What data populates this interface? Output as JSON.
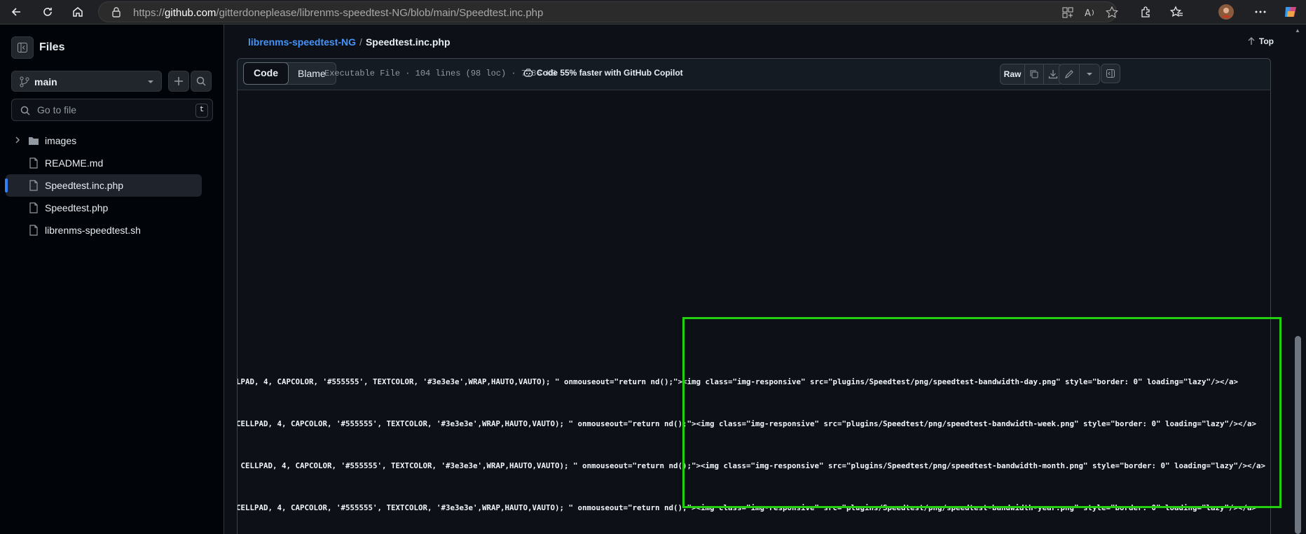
{
  "browser": {
    "url_prefix": "https://",
    "url_host": "github.com",
    "url_path": "/gitterdoneplease/librenms-speedtest-NG/blob/main/Speedtest.inc.php",
    "icons": [
      "back-icon",
      "refresh-icon",
      "home-icon",
      "lock-icon",
      "app-grid-icon",
      "read-aloud-icon",
      "favorite-star-icon",
      "extensions-icon",
      "favorites-icon",
      "profile-avatar",
      "more-icon",
      "copilot-icon"
    ]
  },
  "sidebar": {
    "title": "Files",
    "branch": "main",
    "search_placeholder": "Go to file",
    "search_shortcut": "t",
    "items": [
      {
        "label": "images",
        "type": "folder"
      },
      {
        "label": "README.md",
        "type": "file"
      },
      {
        "label": "Speedtest.inc.php",
        "type": "file",
        "active": true
      },
      {
        "label": "Speedtest.php",
        "type": "file"
      },
      {
        "label": "librenms-speedtest.sh",
        "type": "file"
      }
    ]
  },
  "main": {
    "repo": "librenms-speedtest-NG",
    "separator": "/",
    "file": "Speedtest.inc.php",
    "top_label": "Top",
    "tabs": [
      "Code",
      "Blame"
    ],
    "active_tab": "Code",
    "file_meta": "Executable File · 104 lines (98 loc) · 7.86 KB",
    "copilot_promo": "Code 55% faster with GitHub Copilot",
    "raw_label": "Raw"
  },
  "code_lines": [
    "LPAD, 4, CAPCOLOR, '#555555', TEXTCOLOR, '#3e3e3e',WRAP,HAUTO,VAUTO); \" onmouseout=\"return nd();\"><img class=\"img-responsive\" src=\"plugins/Speedtest/png/speedtest-bandwidth-day.png\" style=\"border: 0\" loading=\"lazy\"/></a>",
    "CELLPAD, 4, CAPCOLOR, '#555555', TEXTCOLOR, '#3e3e3e',WRAP,HAUTO,VAUTO); \" onmouseout=\"return nd();\"><img class=\"img-responsive\" src=\"plugins/Speedtest/png/speedtest-bandwidth-week.png\" style=\"border: 0\" loading=\"lazy\"/></a>",
    " CELLPAD, 4, CAPCOLOR, '#555555', TEXTCOLOR, '#3e3e3e',WRAP,HAUTO,VAUTO); \" onmouseout=\"return nd();\"><img class=\"img-responsive\" src=\"plugins/Speedtest/png/speedtest-bandwidth-month.png\" style=\"border: 0\" loading=\"lazy\"/></a>",
    "CELLPAD, 4, CAPCOLOR, '#555555', TEXTCOLOR, '#3e3e3e',WRAP,HAUTO,VAUTO); \" onmouseout=\"return nd();\"><img class=\"img-responsive\" src=\"plugins/Speedtest/png/speedtest-bandwidth-year.png\" style=\"border: 0\" loading=\"lazy\"/></a>"
  ],
  "colors": {
    "highlight": "#23d00f",
    "link": "#4493f8",
    "background": "#0d1117"
  }
}
